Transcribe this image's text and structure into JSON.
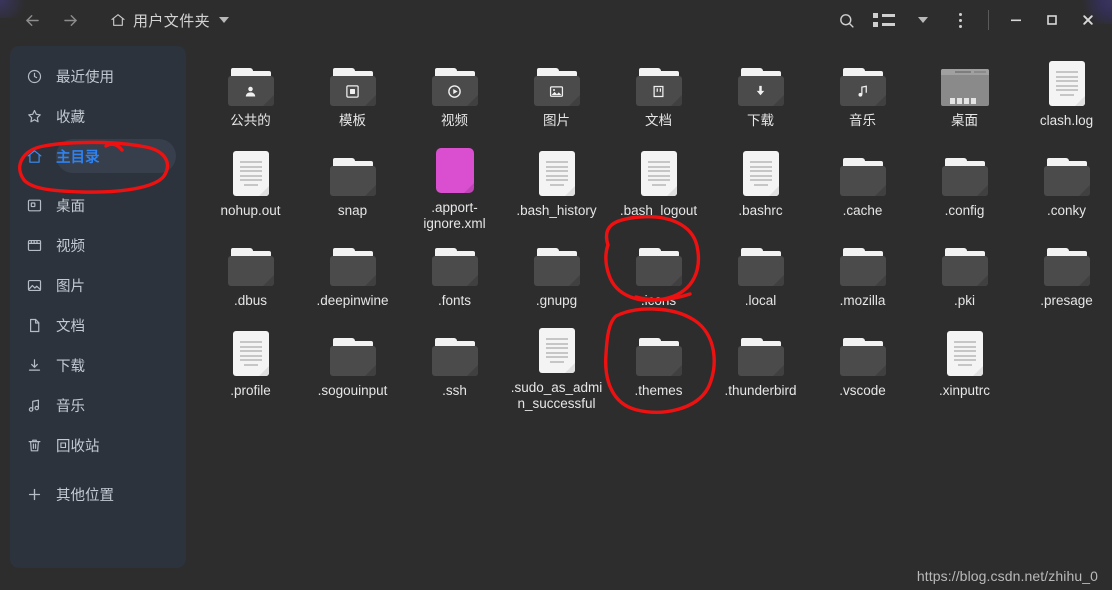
{
  "window": {
    "title": "用户文件夹",
    "watermark": "https://blog.csdn.net/zhihu_0"
  },
  "header": {
    "back_icon": "arrow-left-icon",
    "forward_icon": "arrow-right-icon",
    "home_icon": "home-icon",
    "path_label": "用户文件夹",
    "path_dropdown_icon": "chevron-down-icon",
    "search_icon": "search-icon",
    "view_toggle_icon": "list-view-icon",
    "view_dropdown_icon": "chevron-down-icon",
    "menu_icon": "kebab-menu-icon",
    "minimize_label": "—",
    "maximize_label": "□",
    "close_label": "✕"
  },
  "sidebar": {
    "items": [
      {
        "label": "最近使用",
        "icon": "clock-icon",
        "active": false
      },
      {
        "label": "收藏",
        "icon": "star-icon",
        "active": false
      },
      {
        "label": "主目录",
        "icon": "home-icon",
        "active": true
      },
      {
        "label": "桌面",
        "icon": "desktop-icon",
        "active": false
      },
      {
        "label": "视频",
        "icon": "video-icon",
        "active": false
      },
      {
        "label": "图片",
        "icon": "image-icon",
        "active": false
      },
      {
        "label": "文档",
        "icon": "document-icon",
        "active": false
      },
      {
        "label": "下载",
        "icon": "download-icon",
        "active": false
      },
      {
        "label": "音乐",
        "icon": "music-icon",
        "active": false
      },
      {
        "label": "回收站",
        "icon": "trash-icon",
        "active": false
      },
      {
        "label": "其他位置",
        "icon": "plus-icon",
        "active": false
      }
    ]
  },
  "files": [
    {
      "name": "公共的",
      "type": "folder",
      "glyph": "person-icon"
    },
    {
      "name": "模板",
      "type": "folder",
      "glyph": "template-icon"
    },
    {
      "name": "视频",
      "type": "folder",
      "glyph": "play-icon"
    },
    {
      "name": "图片",
      "type": "folder",
      "glyph": "image-icon"
    },
    {
      "name": "文档",
      "type": "folder",
      "glyph": "document-icon"
    },
    {
      "name": "下载",
      "type": "folder",
      "glyph": "download-icon"
    },
    {
      "name": "音乐",
      "type": "folder",
      "glyph": "music-icon"
    },
    {
      "name": "桌面",
      "type": "desktop",
      "glyph": ""
    },
    {
      "name": "clash.log",
      "type": "file",
      "glyph": ""
    },
    {
      "name": "nohup.out",
      "type": "file",
      "glyph": ""
    },
    {
      "name": "snap",
      "type": "folder",
      "glyph": ""
    },
    {
      "name": ".apport-ignore.xml",
      "type": "code",
      "glyph": "</>"
    },
    {
      "name": ".bash_history",
      "type": "file",
      "glyph": ""
    },
    {
      "name": ".bash_logout",
      "type": "file",
      "glyph": ""
    },
    {
      "name": ".bashrc",
      "type": "file",
      "glyph": ""
    },
    {
      "name": ".cache",
      "type": "folder",
      "glyph": ""
    },
    {
      "name": ".config",
      "type": "folder",
      "glyph": ""
    },
    {
      "name": ".conky",
      "type": "folder",
      "glyph": ""
    },
    {
      "name": ".dbus",
      "type": "folder",
      "glyph": ""
    },
    {
      "name": ".deepinwine",
      "type": "folder",
      "glyph": ""
    },
    {
      "name": ".fonts",
      "type": "folder",
      "glyph": ""
    },
    {
      "name": ".gnupg",
      "type": "folder",
      "glyph": ""
    },
    {
      "name": ".icons",
      "type": "folder",
      "glyph": ""
    },
    {
      "name": ".local",
      "type": "folder",
      "glyph": ""
    },
    {
      "name": ".mozilla",
      "type": "folder",
      "glyph": ""
    },
    {
      "name": ".pki",
      "type": "folder",
      "glyph": ""
    },
    {
      "name": ".presage",
      "type": "folder",
      "glyph": ""
    },
    {
      "name": ".profile",
      "type": "file",
      "glyph": ""
    },
    {
      "name": ".sogouinput",
      "type": "folder",
      "glyph": ""
    },
    {
      "name": ".ssh",
      "type": "folder",
      "glyph": ""
    },
    {
      "name": ".sudo_as_admin_successful",
      "type": "file",
      "glyph": ""
    },
    {
      "name": ".themes",
      "type": "folder",
      "glyph": ""
    },
    {
      "name": ".thunderbird",
      "type": "folder",
      "glyph": ""
    },
    {
      "name": ".vscode",
      "type": "folder",
      "glyph": ""
    },
    {
      "name": ".xinputrc",
      "type": "file",
      "glyph": ""
    }
  ],
  "annotations": {
    "color": "#ee1111",
    "shapes": [
      {
        "target": "sidebar-item-主目录",
        "kind": "ellipse"
      },
      {
        "target": "file-.icons",
        "kind": "ellipse"
      },
      {
        "target": "file-.themes",
        "kind": "ellipse"
      }
    ]
  },
  "colors": {
    "window_bg": "#2d2d2d",
    "sidebar_bg": "#2c333d",
    "accent_blue": "#2f82f0",
    "folder": "#4b4b4b",
    "file": "#f4f4f4",
    "code_magenta": "#da4fd0",
    "annotation_red": "#ee1111"
  }
}
